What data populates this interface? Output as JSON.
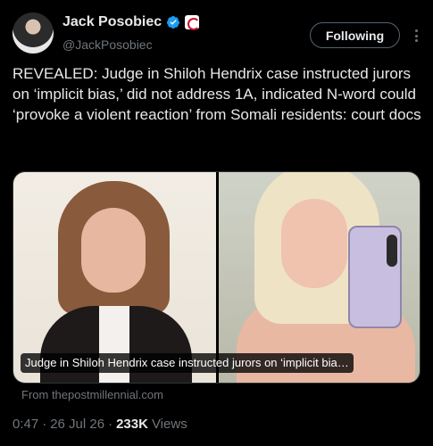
{
  "author": {
    "name": "Jack Posobiec",
    "handle": "@JackPosobiec",
    "verified_icon": "verified-badge-icon",
    "affiliate_icon": "affiliate-badge-icon",
    "avatar_icon": "avatar"
  },
  "follow_button": {
    "label": "Following"
  },
  "more_icon": "more-options-icon",
  "tweet": {
    "text": "REVEALED: Judge in Shiloh Hendrix case instructed jurors on ‘implicit bias,’ did not address 1A, indicated N-word could ‘provoke a violent reaction’ from Somali residents: court docs"
  },
  "card": {
    "caption": "Judge in Shiloh Hendrix case instructed jurors on ‘implicit bia…",
    "source": "From thepostmillennial.com"
  },
  "meta": {
    "time": "0:47",
    "sep1": "·",
    "date": "26 Jul 26",
    "sep2": "·",
    "views_count": "233K",
    "views_label": "Views"
  },
  "colors": {
    "background": "#000000",
    "text_primary": "#e7e9ea",
    "text_secondary": "#71767b",
    "verified_blue": "#1d9bf0"
  }
}
